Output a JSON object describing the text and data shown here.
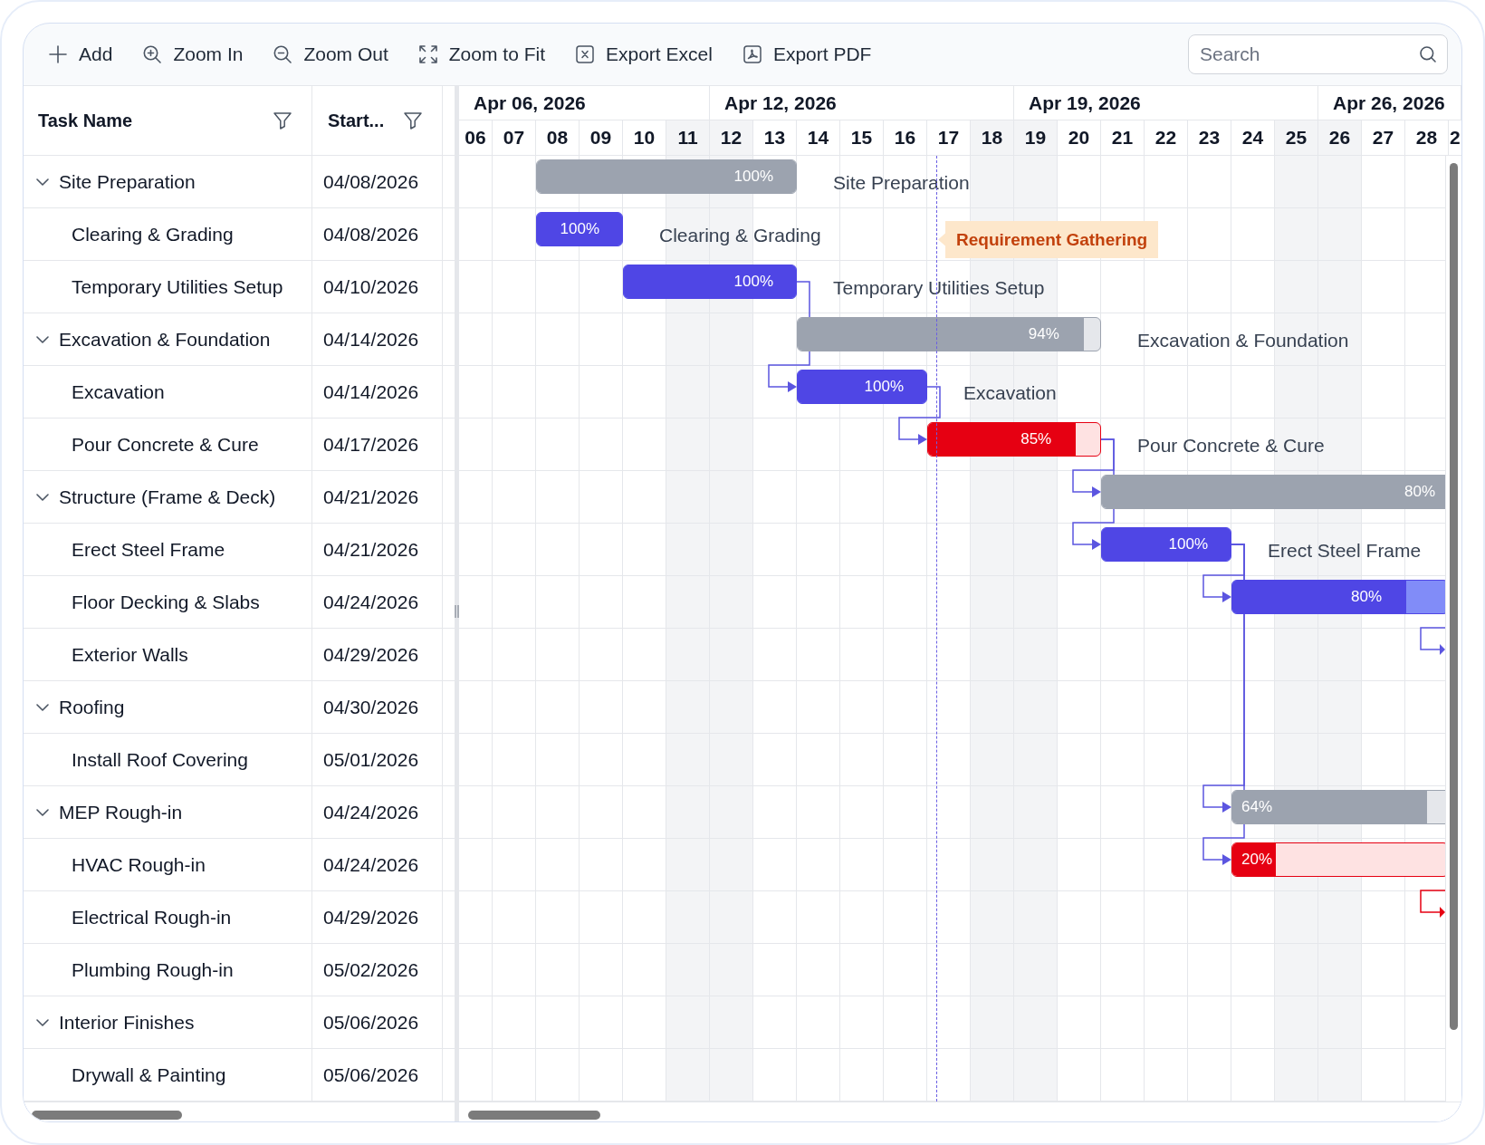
{
  "toolbar": {
    "items": [
      {
        "kind": "add",
        "label": "Add"
      },
      {
        "kind": "zoom-in",
        "label": "Zoom In"
      },
      {
        "kind": "zoom-out",
        "label": "Zoom Out"
      },
      {
        "kind": "zoom-to-fit",
        "label": "Zoom to Fit"
      },
      {
        "kind": "export-excel",
        "label": "Export Excel"
      },
      {
        "kind": "export-pdf",
        "label": "Export PDF"
      }
    ],
    "search": {
      "placeholder": "Search"
    }
  },
  "grid": {
    "columns": [
      {
        "label": "Task Name"
      },
      {
        "label": "Start..."
      }
    ]
  },
  "timeline": {
    "weeks": [
      {
        "label": "Apr 06, 2026",
        "days": [
          {
            "label": "06",
            "weekend": false
          },
          {
            "label": "07",
            "weekend": false
          },
          {
            "label": "08",
            "weekend": false
          },
          {
            "label": "09",
            "weekend": false
          },
          {
            "label": "10",
            "weekend": false
          },
          {
            "label": "11",
            "weekend": true
          }
        ]
      },
      {
        "label": "Apr 12, 2026",
        "days": [
          {
            "label": "12",
            "weekend": true
          },
          {
            "label": "13",
            "weekend": false
          },
          {
            "label": "14",
            "weekend": false
          },
          {
            "label": "15",
            "weekend": false
          },
          {
            "label": "16",
            "weekend": false
          },
          {
            "label": "17",
            "weekend": false
          },
          {
            "label": "18",
            "weekend": true
          }
        ]
      },
      {
        "label": "Apr 19, 2026",
        "days": [
          {
            "label": "19",
            "weekend": true
          },
          {
            "label": "20",
            "weekend": false
          },
          {
            "label": "21",
            "weekend": false
          },
          {
            "label": "22",
            "weekend": false
          },
          {
            "label": "23",
            "weekend": false
          },
          {
            "label": "24",
            "weekend": false
          },
          {
            "label": "25",
            "weekend": true
          }
        ]
      },
      {
        "label": "Apr 26, 2026",
        "days": [
          {
            "label": "26",
            "weekend": true
          },
          {
            "label": "27",
            "weekend": false
          },
          {
            "label": "28",
            "weekend": false
          },
          {
            "label": "2",
            "weekend": false
          }
        ]
      }
    ],
    "event_markers": [
      {
        "label": "Requirement Gathering"
      }
    ]
  },
  "tasks": [
    {
      "name": "Site Preparation",
      "start": "04/08/2026",
      "expanded": true,
      "bar": {
        "kind": "summary",
        "level": 1,
        "progress": "100%",
        "label": "Site Preparation"
      },
      "children": [
        {
          "name": "Clearing & Grading",
          "start": "04/08/2026",
          "bar": {
            "kind": "task",
            "level": 1,
            "progress": "100%",
            "label": "Clearing & Grading"
          }
        },
        {
          "name": "Temporary Utilities Setup",
          "start": "04/10/2026",
          "bar": {
            "kind": "task",
            "level": 1,
            "progress": "100%",
            "label": "Temporary Utilities Setup"
          }
        }
      ]
    },
    {
      "name": "Excavation & Foundation",
      "start": "04/14/2026",
      "expanded": true,
      "bar": {
        "kind": "summary",
        "level": 0.94,
        "progress": "94%",
        "label": "Excavation & Foundation"
      },
      "children": [
        {
          "name": "Excavation",
          "start": "04/14/2026",
          "bar": {
            "kind": "task",
            "level": 1,
            "progress": "100%",
            "label": "Excavation"
          }
        },
        {
          "name": "Pour Concrete & Cure",
          "start": "04/17/2026",
          "bar": {
            "kind": "critical",
            "level": 0.85,
            "progress": "85%",
            "label": "Pour Concrete & Cure"
          }
        }
      ]
    },
    {
      "name": "Structure (Frame & Deck)",
      "start": "04/21/2026",
      "expanded": true,
      "bar": {
        "kind": "summary",
        "level": 0.8,
        "progress": "80%"
      },
      "children": [
        {
          "name": "Erect Steel Frame",
          "start": "04/21/2026",
          "bar": {
            "kind": "task",
            "level": 1,
            "progress": "100%",
            "label": "Erect Steel Frame"
          }
        },
        {
          "name": "Floor Decking & Slabs",
          "start": "04/24/2026",
          "bar": {
            "kind": "task",
            "level": 0.8,
            "progress": "80%"
          }
        },
        {
          "name": "Exterior Walls",
          "start": "04/29/2026"
        }
      ]
    },
    {
      "name": "Roofing",
      "start": "04/30/2026",
      "expanded": true,
      "children": [
        {
          "name": "Install Roof Covering",
          "start": "05/01/2026"
        }
      ]
    },
    {
      "name": "MEP Rough-in",
      "start": "04/24/2026",
      "expanded": true,
      "bar": {
        "kind": "summary",
        "level": 0.64,
        "progress": "64%"
      },
      "children": [
        {
          "name": "HVAC Rough-in",
          "start": "04/24/2026",
          "bar": {
            "kind": "critical",
            "level": 0.2,
            "progress": "20%"
          }
        },
        {
          "name": "Electrical Rough-in",
          "start": "04/29/2026"
        },
        {
          "name": "Plumbing Rough-in",
          "start": "05/02/2026"
        }
      ]
    },
    {
      "name": "Interior Finishes",
      "start": "05/06/2026",
      "expanded": true,
      "children": [
        {
          "name": "Drywall & Painting",
          "start": "05/06/2026"
        }
      ]
    }
  ],
  "dependency_links": [
    {
      "critical": false
    },
    {
      "critical": false
    },
    {
      "critical": false
    },
    {
      "critical": false
    },
    {
      "critical": false
    },
    {
      "critical": false
    },
    {
      "critical": false
    },
    {
      "critical": false
    },
    {
      "critical": true
    }
  ]
}
